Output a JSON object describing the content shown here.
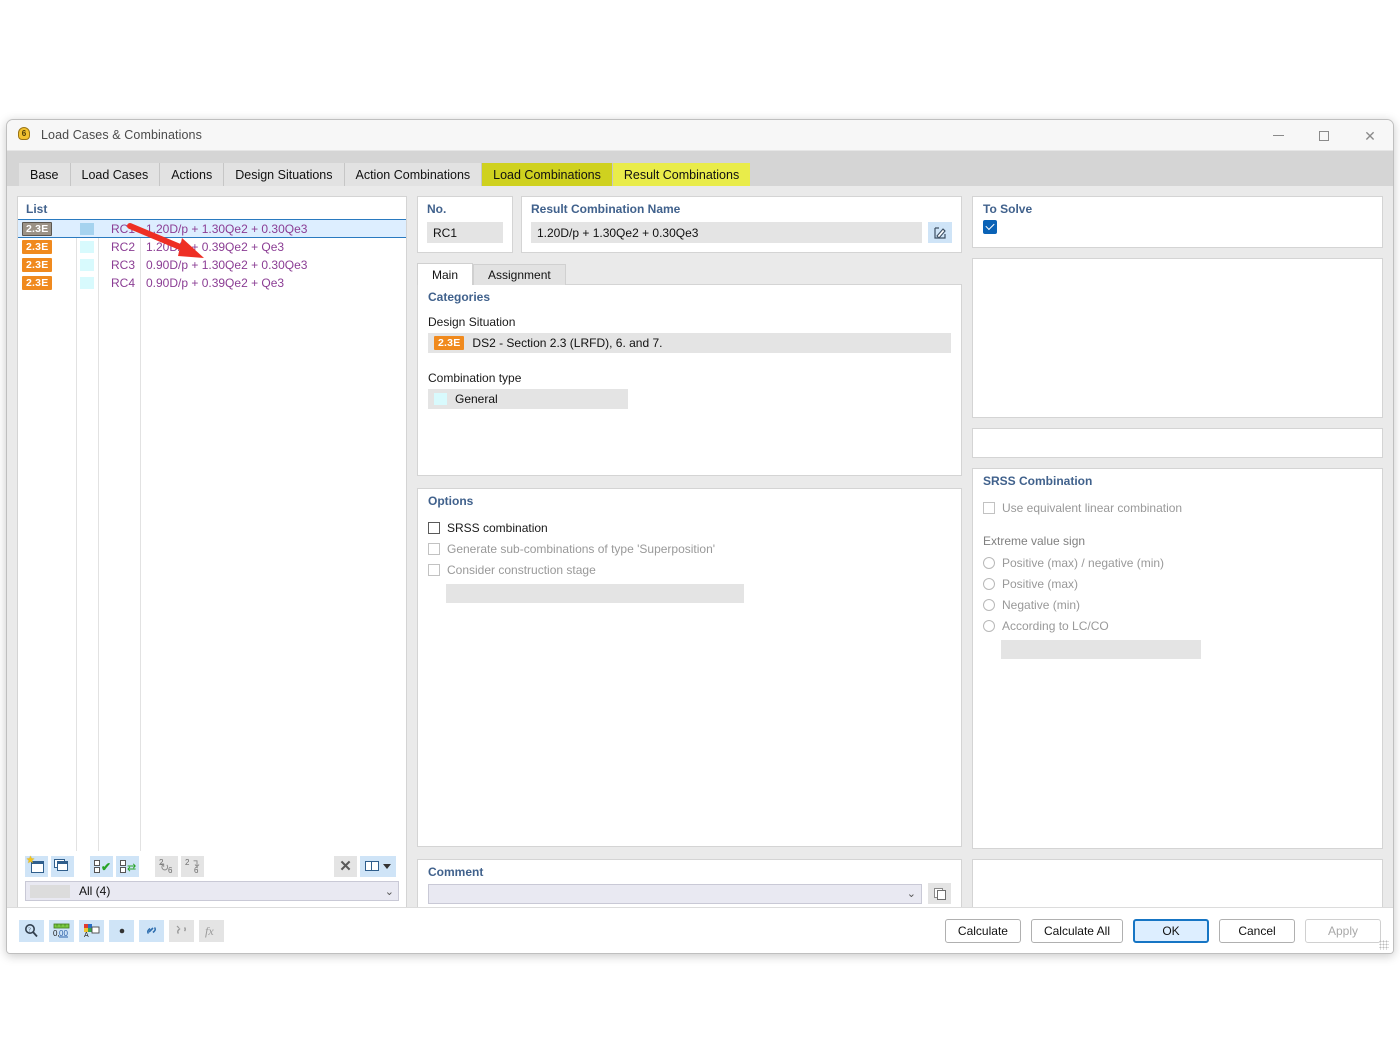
{
  "window": {
    "title": "Load Cases & Combinations",
    "app_icon": "lightbulb-6-icon",
    "minimize": "minimize-icon",
    "maximize": "maximize-icon",
    "close": "close-icon"
  },
  "tabs": [
    {
      "label": "Base",
      "state": "normal"
    },
    {
      "label": "Load Cases",
      "state": "normal"
    },
    {
      "label": "Actions",
      "state": "normal"
    },
    {
      "label": "Design Situations",
      "state": "normal"
    },
    {
      "label": "Action Combinations",
      "state": "normal"
    },
    {
      "label": "Load Combinations",
      "state": "highlight-dark"
    },
    {
      "label": "Result Combinations",
      "state": "highlight-bright"
    }
  ],
  "list": {
    "legend": "List",
    "rows": [
      {
        "ds": "2.3E",
        "no": "RC1",
        "name": "1.20D/p + 1.30Qe2 + 0.30Qe3",
        "selected": true
      },
      {
        "ds": "2.3E",
        "no": "RC2",
        "name": "1.20D/p + 0.39Qe2 + Qe3",
        "selected": false
      },
      {
        "ds": "2.3E",
        "no": "RC3",
        "name": "0.90D/p + 1.30Qe2 + 0.30Qe3",
        "selected": false
      },
      {
        "ds": "2.3E",
        "no": "RC4",
        "name": "0.90D/p + 0.39Qe2 + Qe3",
        "selected": false
      }
    ],
    "toolbar": [
      {
        "icon": "new-combination-icon",
        "enabled": true
      },
      {
        "icon": "duplicate-combination-icon",
        "enabled": true
      },
      {
        "icon": "select-all-icon",
        "enabled": true
      },
      {
        "icon": "invert-selection-icon",
        "enabled": true
      },
      {
        "icon": "renumber-icon",
        "enabled": false
      },
      {
        "icon": "renumber-from-icon",
        "enabled": false
      },
      {
        "icon": "delete-icon",
        "enabled": true
      },
      {
        "icon": "columns-icon",
        "enabled": true
      }
    ],
    "filter_value": "All (4)",
    "filter_chevron": "chevron-down-icon"
  },
  "fields": {
    "no_label": "No.",
    "no_value": "RC1",
    "name_label": "Result Combination Name",
    "name_value": "1.20D/p + 1.30Qe2 + 0.30Qe3",
    "edit_icon": "edit-pencil-icon"
  },
  "to_solve": {
    "legend": "To Solve",
    "checked": true,
    "checkbox_icon": "check-icon"
  },
  "inner_tabs": [
    {
      "label": "Main",
      "active": true
    },
    {
      "label": "Assignment",
      "active": false
    }
  ],
  "categories": {
    "legend": "Categories",
    "design_situation_label": "Design Situation",
    "design_situation_badge": "2.3E",
    "design_situation_value": "DS2 - Section 2.3 (LRFD), 6. and 7.",
    "combination_type_label": "Combination type",
    "combination_type_value": "General"
  },
  "options": {
    "legend": "Options",
    "items": [
      {
        "label": "SRSS combination",
        "checked": false,
        "enabled": true
      },
      {
        "label": "Generate sub-combinations of type 'Superposition'",
        "checked": false,
        "enabled": false
      },
      {
        "label": "Consider construction stage",
        "checked": false,
        "enabled": false
      }
    ]
  },
  "srss": {
    "legend": "SRSS Combination",
    "use_equivalent_label": "Use equivalent linear combination",
    "use_equivalent_checked": false,
    "extreme_value_label": "Extreme value sign",
    "radios": [
      {
        "label": "Positive (max) / negative (min)",
        "selected": false
      },
      {
        "label": "Positive (max)",
        "selected": false
      },
      {
        "label": "Negative (min)",
        "selected": false
      },
      {
        "label": "According to LC/CO",
        "selected": false
      }
    ]
  },
  "comment": {
    "legend": "Comment",
    "value": "",
    "chevron": "chevron-down-icon",
    "copy_icon": "copy-icon"
  },
  "footer": {
    "icons": [
      {
        "icon": "magnifier-icon",
        "enabled": true
      },
      {
        "icon": "units-0-00-icon",
        "enabled": true
      },
      {
        "icon": "colors-dialog-icon",
        "enabled": true
      },
      {
        "icon": "dot-icon",
        "enabled": true
      },
      {
        "icon": "link-icon",
        "enabled": true
      },
      {
        "icon": "unlink-icon",
        "enabled": false
      },
      {
        "icon": "formula-fx-icon",
        "enabled": false
      }
    ],
    "buttons": [
      {
        "label": "Calculate",
        "style": "normal"
      },
      {
        "label": "Calculate All",
        "style": "normal"
      },
      {
        "label": "OK",
        "style": "primary"
      },
      {
        "label": "Cancel",
        "style": "normal"
      },
      {
        "label": "Apply",
        "style": "disabled"
      }
    ]
  },
  "annotation": {
    "arrow_color": "#ee2f24",
    "points_to": "first-list-row"
  }
}
